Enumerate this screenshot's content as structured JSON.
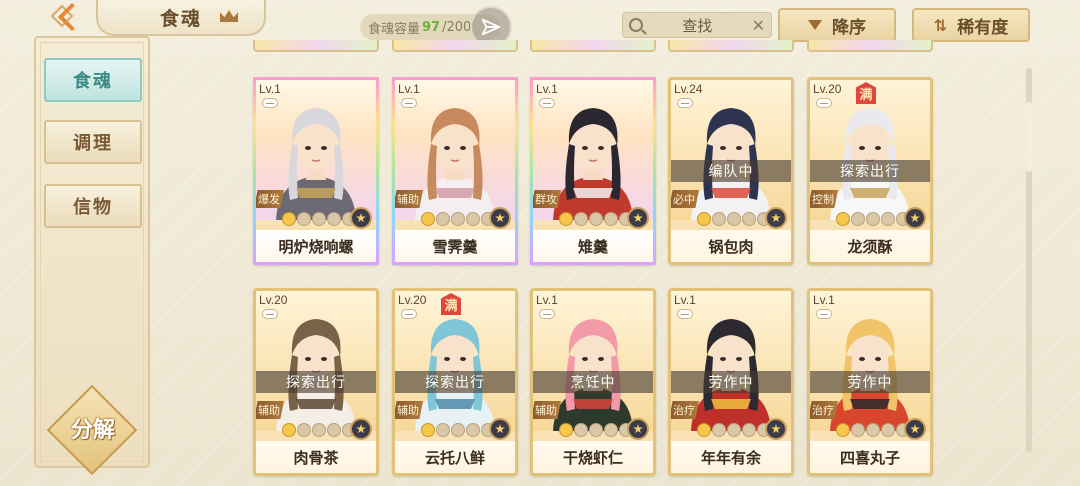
{
  "header": {
    "title": "食魂",
    "capacity_label": "食魂容量",
    "capacity_current": "97",
    "capacity_sep_total": "/200",
    "search_placeholder": "查找",
    "sort_order": "降序",
    "sort_by": "稀有度"
  },
  "sidebar": {
    "tabs": [
      {
        "label": "食魂",
        "active": true
      },
      {
        "label": "调理",
        "active": false
      },
      {
        "label": "信物",
        "active": false
      }
    ],
    "decompose_label": "分解"
  },
  "cards": [
    {
      "name": "明炉烧响螺",
      "level": "Lv.1",
      "role": "爆发",
      "status": "",
      "full": "",
      "rainbow": true,
      "hair": "#d8d8dc",
      "cloth": "#6b6a74",
      "accent": "#c9a25a"
    },
    {
      "name": "雪霁羹",
      "level": "Lv.1",
      "role": "辅助",
      "status": "",
      "full": "",
      "rainbow": true,
      "hair": "#c78a5e",
      "cloth": "#f4eef0",
      "accent": "#d69aa6"
    },
    {
      "name": "雉羹",
      "level": "Lv.1",
      "role": "群攻",
      "status": "",
      "full": "",
      "rainbow": true,
      "hair": "#2b2730",
      "cloth": "#c0392b",
      "accent": "#f1f1f1"
    },
    {
      "name": "锅包肉",
      "level": "Lv.24",
      "role": "必中",
      "status": "编队中",
      "full": "",
      "rainbow": false,
      "hair": "#2e3450",
      "cloth": "#f2f2f2",
      "accent": "#d84a3a"
    },
    {
      "name": "龙须酥",
      "level": "Lv.20",
      "role": "控制",
      "status": "探索出行",
      "full": "满",
      "rainbow": false,
      "hair": "#e9e9ee",
      "cloth": "#f7f7f7",
      "accent": "#c9a25a"
    },
    {
      "name": "肉骨茶",
      "level": "Lv.20",
      "role": "辅助",
      "status": "探索出行",
      "full": "",
      "rainbow": false,
      "hair": "#7a6248",
      "cloth": "#f3efe6",
      "accent": "#5a4630"
    },
    {
      "name": "云托八鲜",
      "level": "Lv.20",
      "role": "辅助",
      "status": "探索出行",
      "full": "满",
      "rainbow": false,
      "hair": "#7fc6d6",
      "cloth": "#e8f1f4",
      "accent": "#4a8aa8"
    },
    {
      "name": "干烧虾仁",
      "level": "Lv.1",
      "role": "辅助",
      "status": "烹饪中",
      "full": "",
      "rainbow": false,
      "hair": "#f29aa8",
      "cloth": "#2f3a2f",
      "accent": "#d8453a"
    },
    {
      "name": "年年有余",
      "level": "Lv.1",
      "role": "治疗",
      "status": "劳作中",
      "full": "",
      "rainbow": false,
      "hair": "#2c2a30",
      "cloth": "#c0302a",
      "accent": "#f0c040"
    },
    {
      "name": "四喜丸子",
      "level": "Lv.1",
      "role": "治疗",
      "status": "劳作中",
      "full": "",
      "rainbow": false,
      "hair": "#f2c46a",
      "cloth": "#d8462e",
      "accent": "#2a2a2a"
    }
  ],
  "colors": {
    "accent_orange": "#e58a3a",
    "active_tab_teal": "#3b8a85",
    "capacity_green": "#6ab13a",
    "full_badge_red": "#e0463b"
  }
}
